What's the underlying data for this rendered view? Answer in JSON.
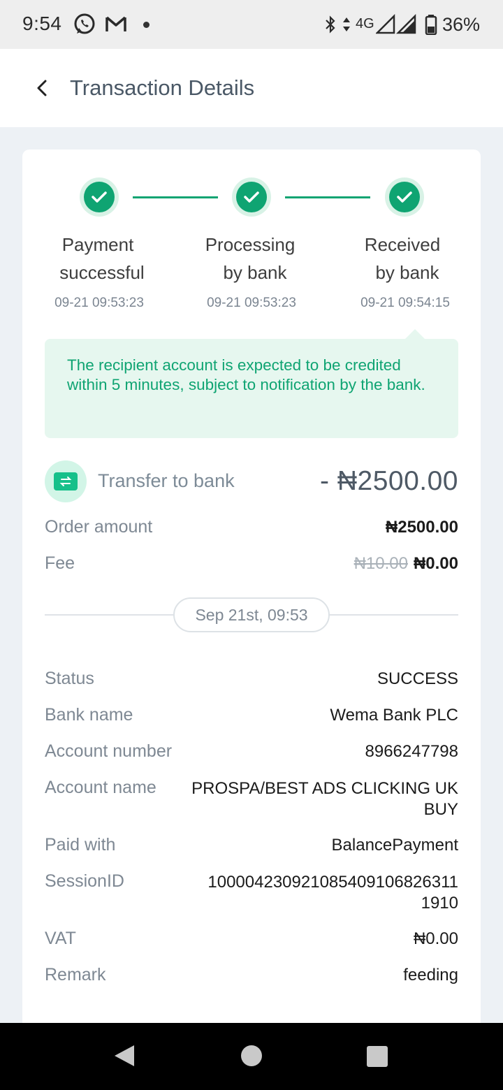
{
  "status_bar": {
    "time": "9:54",
    "network": "4G",
    "battery": "36%",
    "icons": [
      "whatsapp-icon",
      "gmail-icon",
      "bluetooth-icon",
      "signal-icon",
      "battery-icon"
    ]
  },
  "header": {
    "title": "Transaction Details"
  },
  "progress": {
    "steps": [
      {
        "label_line1": "Payment",
        "label_line2": "successful",
        "time": "09-21 09:53:23"
      },
      {
        "label_line1": "Processing",
        "label_line2": "by bank",
        "time": "09-21 09:53:23"
      },
      {
        "label_line1": "Received",
        "label_line2": "by bank",
        "time": "09-21 09:54:15"
      }
    ]
  },
  "notice": {
    "text": "The recipient account is expected to be credited within 5 minutes, subject to notification by the bank."
  },
  "transaction": {
    "type_label": "Transfer to bank",
    "amount": "- ₦2500.00",
    "order_amount_label": "Order amount",
    "order_amount": "₦2500.00",
    "fee_label": "Fee",
    "fee_original": "₦10.00",
    "fee": "₦0.00",
    "date": "Sep 21st, 09:53"
  },
  "details": {
    "status_label": "Status",
    "status": "SUCCESS",
    "bank_name_label": "Bank name",
    "bank_name": "Wema Bank PLC",
    "account_number_label": "Account number",
    "account_number": "8966247798",
    "account_name_label": "Account name",
    "account_name_line1": "PROSPA/BEST ADS CLICKING UK",
    "account_name_line2": "BUY",
    "paid_with_label": "Paid with",
    "paid_with": "BalancePayment",
    "session_label": "SessionID",
    "session_line1": "100004230921085409106826311",
    "session_line2": "1910",
    "vat_label": "VAT",
    "vat": "₦0.00",
    "remark_label": "Remark",
    "remark": "feeding"
  },
  "colors": {
    "accent": "#0fa472",
    "notice_bg": "#e6f7ef",
    "page_bg": "#edf1f5"
  }
}
